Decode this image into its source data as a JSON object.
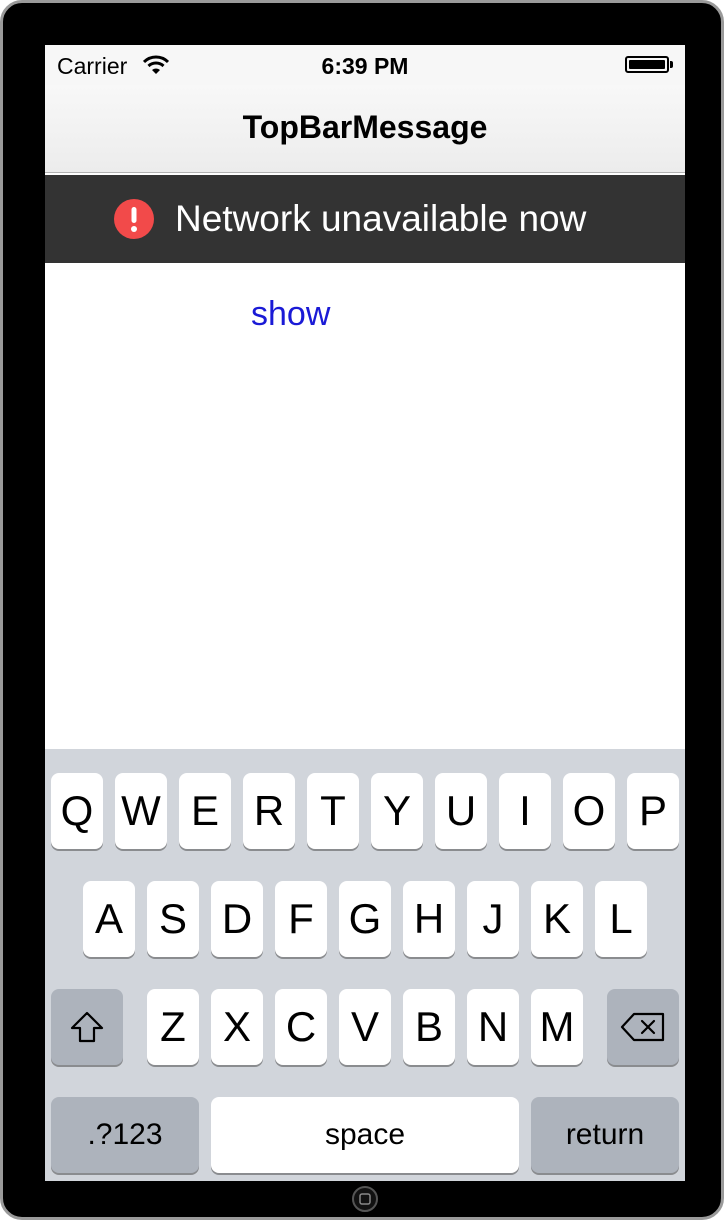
{
  "status_bar": {
    "carrier": "Carrier",
    "time": "6:39 PM",
    "icons": [
      "wifi-icon",
      "battery-icon"
    ]
  },
  "navbar": {
    "title": "TopBarMessage"
  },
  "banner": {
    "icon": "exclamation-circle-icon",
    "icon_color": "#f24a4a",
    "message": "Network unavailable now",
    "background": "#333333"
  },
  "content": {
    "show_label": "show",
    "link_color": "#1a1ad6"
  },
  "keyboard": {
    "row1": [
      "Q",
      "W",
      "E",
      "R",
      "T",
      "Y",
      "U",
      "I",
      "O",
      "P"
    ],
    "row2": [
      "A",
      "S",
      "D",
      "F",
      "G",
      "H",
      "J",
      "K",
      "L"
    ],
    "row3": [
      "Z",
      "X",
      "C",
      "V",
      "B",
      "N",
      "M"
    ],
    "shift_icon": "shift-icon",
    "delete_icon": "backspace-icon",
    "numbers_label": ".?123",
    "space_label": "space",
    "return_label": "return"
  }
}
